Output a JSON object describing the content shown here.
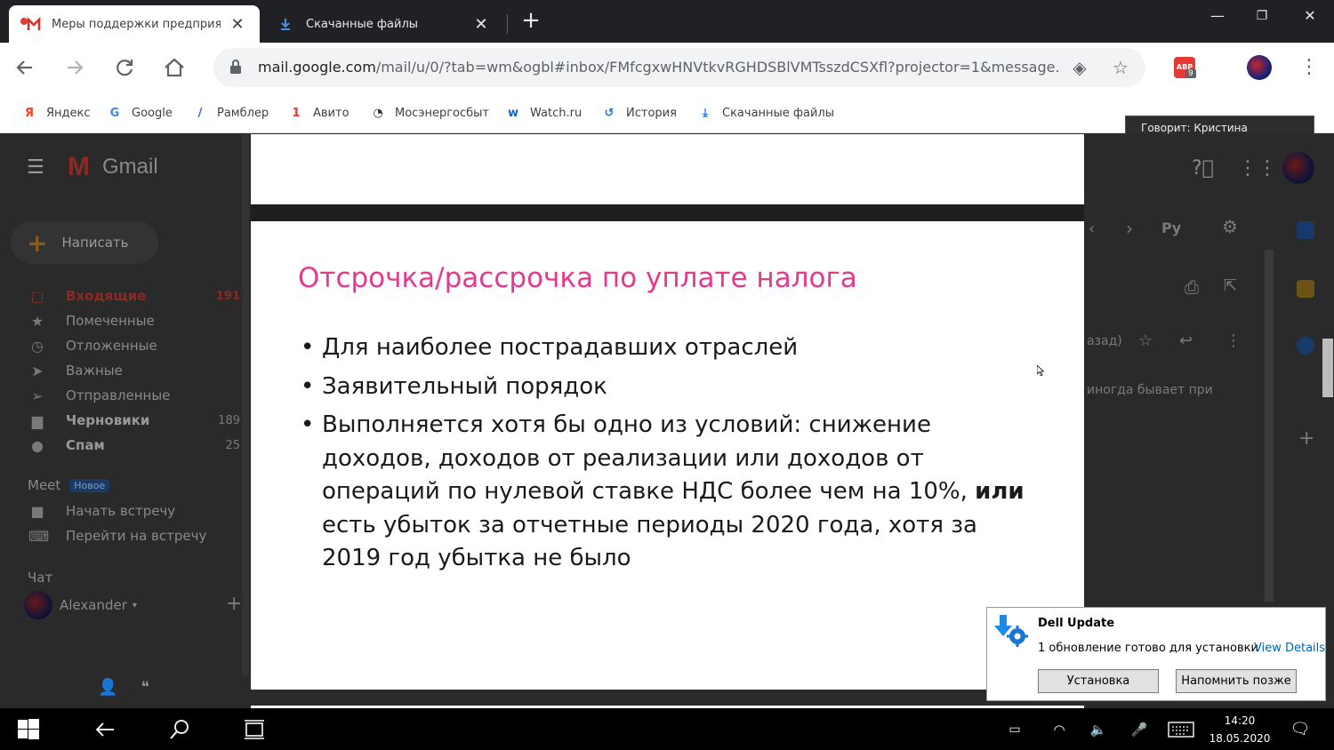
{
  "browser": {
    "tabs": [
      {
        "title": "Меры поддержки предприятий"
      },
      {
        "title": "Скачанные файлы"
      }
    ],
    "url_host": "mail.google.com",
    "url_rest": "/mail/u/0/?tab=wm&ogbl#inbox/FMfcgxwHNVtkvRGHDSBlVMTsszdCSXfl?projector=1&message...",
    "abp_label": "ABP",
    "abp_count": "9",
    "bookmarks": [
      {
        "label": "Яндекс",
        "icon": "yandex-icon",
        "glyph": "Я",
        "color": "#fc3f1d"
      },
      {
        "label": "Google",
        "icon": "google-icon",
        "glyph": "G",
        "color": "#4285f4"
      },
      {
        "label": "Рамблер",
        "icon": "rambler-icon",
        "glyph": "/",
        "color": "#315efb"
      },
      {
        "label": "Авито",
        "icon": "avito-icon",
        "glyph": "1",
        "color": "#e53935"
      },
      {
        "label": "Мосэнергосбыт",
        "icon": "mosenergosbyt-icon",
        "glyph": "◔",
        "color": "#333333"
      },
      {
        "label": "Watch.ru",
        "icon": "watch-icon",
        "glyph": "w",
        "color": "#1565c0"
      },
      {
        "label": "История",
        "icon": "history-icon",
        "glyph": "↺",
        "color": "#1a73e8"
      },
      {
        "label": "Скачанные файлы",
        "icon": "download-icon",
        "glyph": "⤓",
        "color": "#1a73e8"
      }
    ],
    "tooltip": "Говорит: Кристина"
  },
  "gmail": {
    "logo_text": "Gmail",
    "compose_label": "Написать",
    "nav": [
      {
        "label": "Входящие",
        "count": "191",
        "icon": "inbox-icon",
        "glyph": "▢",
        "active": true
      },
      {
        "label": "Помеченные",
        "count": "",
        "icon": "star-icon",
        "glyph": "★"
      },
      {
        "label": "Отложенные",
        "count": "",
        "icon": "clock-icon",
        "glyph": "◷"
      },
      {
        "label": "Важные",
        "count": "",
        "icon": "important-icon",
        "glyph": "➤"
      },
      {
        "label": "Отправленные",
        "count": "",
        "icon": "send-icon",
        "glyph": "➢"
      },
      {
        "label": "Черновики",
        "count": "189",
        "icon": "draft-icon",
        "glyph": "▆",
        "bold": true
      },
      {
        "label": "Спам",
        "count": "25",
        "icon": "spam-icon",
        "glyph": "●",
        "bold": true
      }
    ],
    "meet_heading": "Meet",
    "meet_badge": "Новое",
    "meet_items": [
      {
        "label": "Начать встречу",
        "icon": "video-icon",
        "glyph": "■"
      },
      {
        "label": "Перейти на встречу",
        "icon": "keyboard-icon",
        "glyph": "⌨"
      }
    ],
    "chat_heading": "Чат",
    "chat_user": "Alexander",
    "lang_label": "Ру",
    "reply_back_text": "азад)",
    "snippet_text": "иногда бывает при"
  },
  "slide": {
    "title": "Отсрочка/рассрочка по уплате налога",
    "bullet1": "Для наиболее пострадавших отраслей",
    "bullet2": "Заявительный порядок",
    "bullet3_part1": "Выполняется хотя бы одно из условий: снижение доходов, доходов от реализации или доходов от операций по нулевой ставке НДС более чем на 10%, ",
    "bullet3_bold": "или",
    "bullet3_part2": " есть убыток за отчетные периоды 2020 года, хотя за 2019 год убытка не было"
  },
  "toast": {
    "title": "Dell Update",
    "message": "1 обновление готово для установки",
    "link": "View Details",
    "install_label": "Установка",
    "later_label": "Напомнить позже"
  },
  "taskbar": {
    "time": "14:20",
    "date": "18.05.2020"
  },
  "colors": {
    "title_accent": "#e4398f",
    "gmail_active": "#8b2a22",
    "link_blue": "#0063b1"
  }
}
